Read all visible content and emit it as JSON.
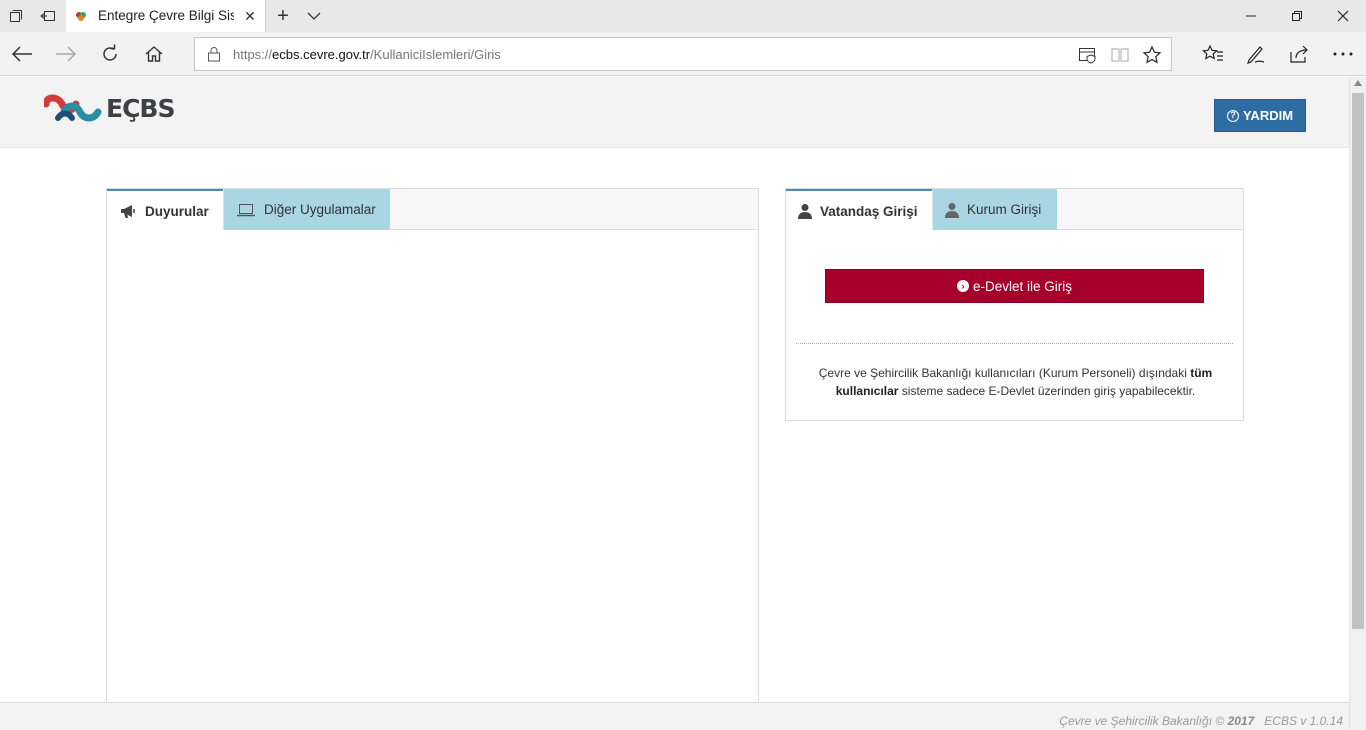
{
  "browser": {
    "tab_title": "Entegre Çevre Bilgi Siste",
    "url_prefix": "https://",
    "url_host": "ecbs.cevre.gov.tr",
    "url_path": "/KullaniciIslemleri/Giris"
  },
  "header": {
    "logo_text": "EÇBS",
    "help_label": "YARDIM"
  },
  "left_panel": {
    "tabs": [
      {
        "label": "Duyurular",
        "icon": "megaphone-icon",
        "active": true
      },
      {
        "label": "Diğer Uygulamalar",
        "icon": "laptop-icon",
        "active": false
      }
    ]
  },
  "right_panel": {
    "tabs": [
      {
        "label": "Vatandaş Girişi",
        "icon": "user-icon",
        "active": true
      },
      {
        "label": "Kurum Girişi",
        "icon": "user-icon",
        "active": false
      }
    ],
    "edevlet_label": "e-Devlet ile Giriş",
    "info_part1": "Çevre ve Şehircilik Bakanlığı kullanıcıları (Kurum Personeli) dışındaki ",
    "info_bold": "tüm kullanıcılar",
    "info_part2": " sisteme sadece E-Devlet üzerinden giriş yapabilecektir."
  },
  "footer": {
    "ministry": "Çevre ve Şehircilik Bakanlığı",
    "year": "2017",
    "version": "ECBS v 1.0.14"
  },
  "colors": {
    "edevlet_red": "#a6002b",
    "help_blue": "#2e6da4",
    "tab_alt_bg": "#a9d6e2"
  }
}
